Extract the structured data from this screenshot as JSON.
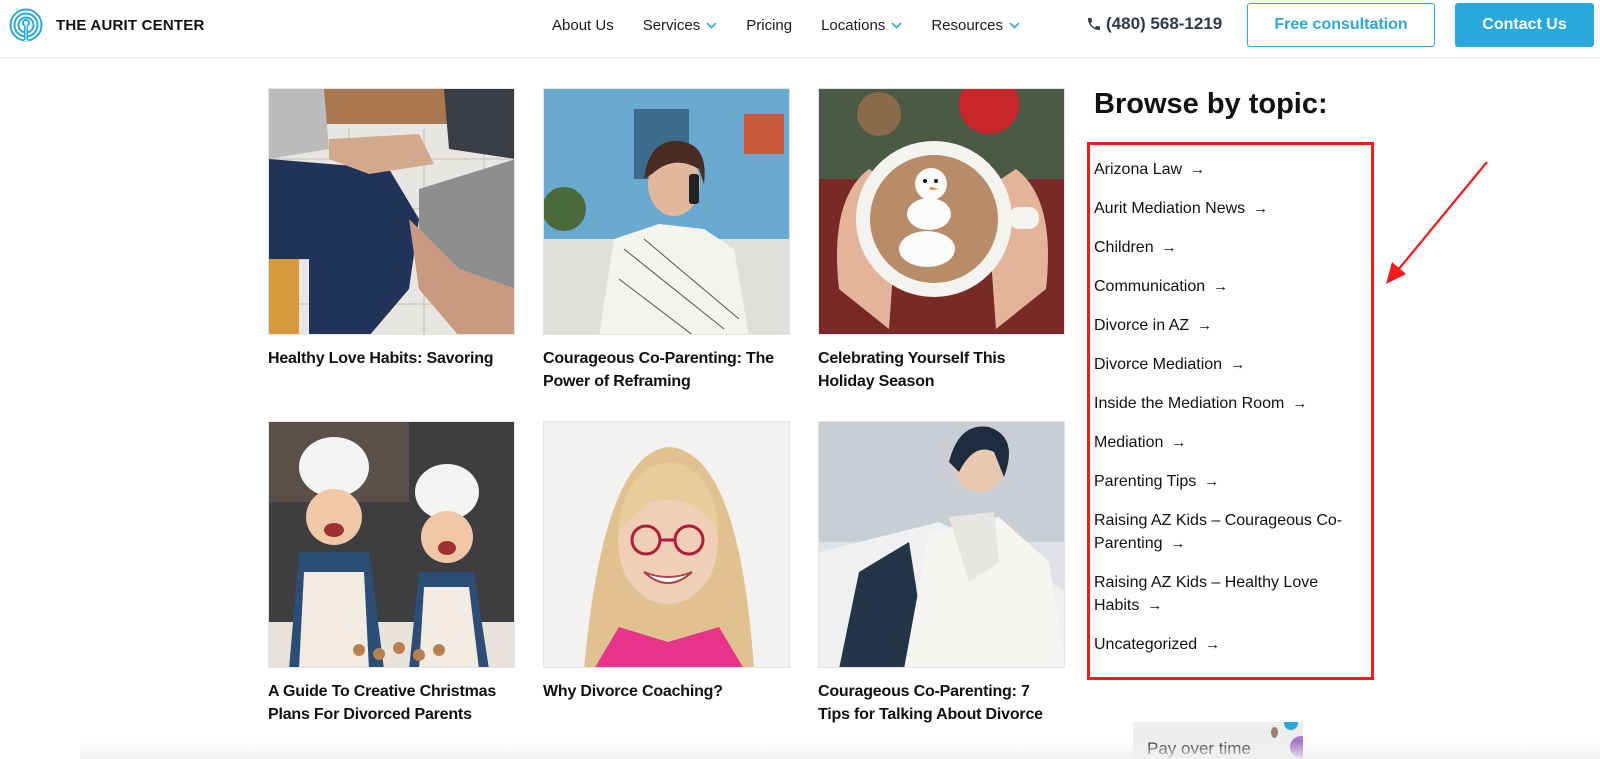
{
  "header": {
    "brand": "THE AURIT CENTER",
    "nav": [
      {
        "label": "About Us",
        "has_dropdown": false
      },
      {
        "label": "Services",
        "has_dropdown": true
      },
      {
        "label": "Pricing",
        "has_dropdown": false
      },
      {
        "label": "Locations",
        "has_dropdown": true
      },
      {
        "label": "Resources",
        "has_dropdown": true
      }
    ],
    "phone": "(480) 568-1219",
    "free_consultation_label": "Free consultation",
    "contact_label": "Contact Us",
    "accent_color": "#29a8dc"
  },
  "posts": [
    {
      "title": "Healthy Love Habits: Savoring",
      "image": "couple-holding-hands"
    },
    {
      "title": "Courageous Co-Parenting: The Power of Reframing",
      "image": "woman-on-phone"
    },
    {
      "title": "Celebrating Yourself This Holiday Season",
      "image": "snowman-hot-cocoa"
    },
    {
      "title": "A Guide To Creative Christmas Plans For Divorced Parents",
      "image": "kids-baking"
    },
    {
      "title": "Why Divorce Coaching?",
      "image": "smiling-woman-portrait"
    },
    {
      "title": "Courageous Co-Parenting: 7 Tips for Talking About Divorce",
      "image": "couple-conversation"
    }
  ],
  "sidebar": {
    "title": "Browse by topic:",
    "topics": [
      "Arizona Law",
      "Aurit Mediation News",
      "Children",
      "Communication",
      "Divorce in AZ",
      "Divorce Mediation",
      "Inside the Mediation Room",
      "Mediation",
      "Parenting Tips",
      "Raising AZ Kids – Courageous Co-Parenting",
      "Raising AZ Kids – Healthy Love Habits",
      "Uncategorized"
    ],
    "arrow_glyph": "→",
    "highlight_color": "#f21a1a"
  },
  "pay_card": {
    "label": "Pay over time"
  }
}
